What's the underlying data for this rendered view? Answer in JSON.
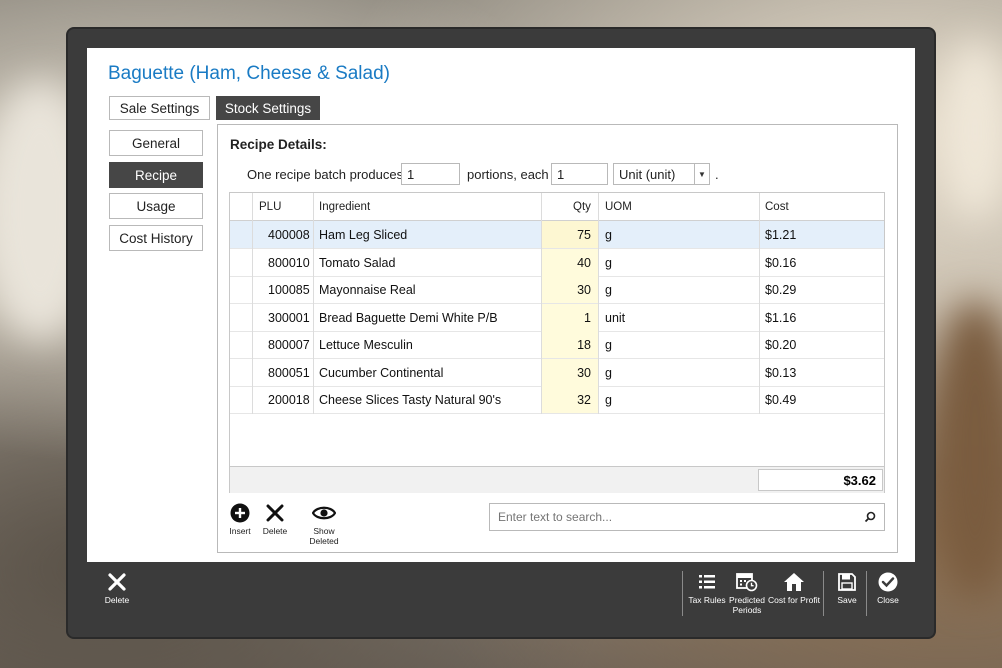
{
  "app": {
    "title": "Baguette (Ham, Cheese & Salad)"
  },
  "top_tabs": [
    {
      "label": "Sale Settings",
      "active": false
    },
    {
      "label": "Stock Settings",
      "active": true
    }
  ],
  "side_nav": [
    {
      "label": "General",
      "active": false
    },
    {
      "label": "Recipe",
      "active": true
    },
    {
      "label": "Usage",
      "active": false
    },
    {
      "label": "Cost History",
      "active": false
    }
  ],
  "recipe": {
    "heading": "Recipe Details:",
    "batch_label": "One recipe batch produces:",
    "batch_value": "1",
    "portions_label": "portions, each",
    "portions_value": "1",
    "unit_value": "Unit (unit)",
    "trailing": "."
  },
  "table": {
    "columns": [
      "PLU",
      "Ingredient",
      "Qty",
      "UOM",
      "Cost"
    ],
    "rows": [
      {
        "plu": "400008",
        "ingredient": "Ham Leg Sliced",
        "qty": "75",
        "uom": "g",
        "cost": "$1.21",
        "selected": true
      },
      {
        "plu": "800010",
        "ingredient": "Tomato Salad",
        "qty": "40",
        "uom": "g",
        "cost": "$0.16"
      },
      {
        "plu": "100085",
        "ingredient": "Mayonnaise Real",
        "qty": "30",
        "uom": "g",
        "cost": "$0.29"
      },
      {
        "plu": "300001",
        "ingredient": "Bread Baguette Demi White P/B",
        "qty": "1",
        "uom": "unit",
        "cost": "$1.16"
      },
      {
        "plu": "800007",
        "ingredient": "Lettuce Mesculin",
        "qty": "18",
        "uom": "g",
        "cost": "$0.20"
      },
      {
        "plu": "800051",
        "ingredient": "Cucumber Continental",
        "qty": "30",
        "uom": "g",
        "cost": "$0.13"
      },
      {
        "plu": "200018",
        "ingredient": "Cheese Slices Tasty Natural 90's",
        "qty": "32",
        "uom": "g",
        "cost": "$0.49"
      }
    ],
    "total": "$3.62"
  },
  "grid_toolbar": {
    "insert_label": "Insert",
    "delete_label": "Delete",
    "show_deleted_label": "Show Deleted",
    "search_placeholder": "Enter text to search..."
  },
  "bottom_bar": {
    "delete_label": "Delete",
    "tax_rules_label": "Tax Rules",
    "predicted_periods_label_1": "Predicted",
    "predicted_periods_label_2": "Periods",
    "cost_for_profit_label": "Cost for Profit",
    "save_label": "Save",
    "close_label": "Close"
  },
  "colors": {
    "accent_blue": "#1a7bc4",
    "dark_button": "#464646",
    "frame": "#3b3b3b",
    "qty_highlight": "#fffbdc",
    "row_selected": "#e4effa"
  }
}
